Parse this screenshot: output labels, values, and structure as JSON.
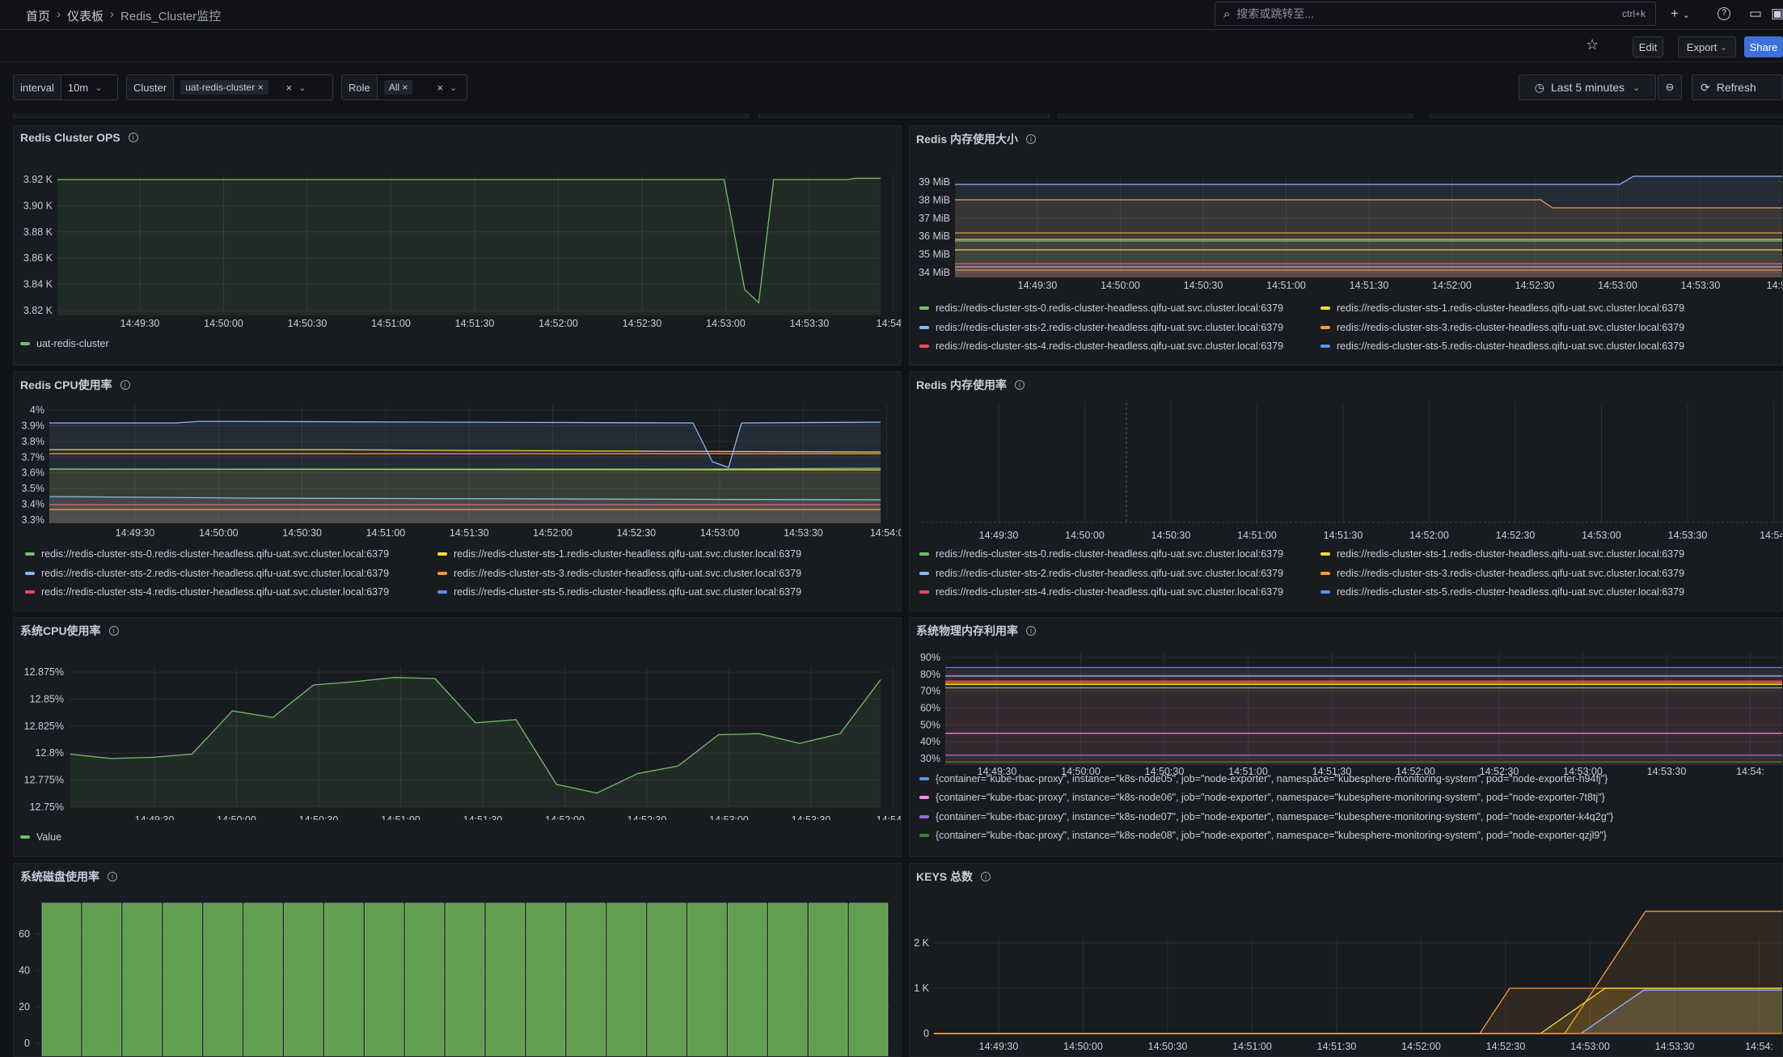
{
  "breadcrumb": {
    "home": "首页",
    "dashboards": "仪表板",
    "current": "Redis_Cluster监控"
  },
  "search": {
    "placeholder": "搜索或跳转至...",
    "shortcut": "ctrl+k"
  },
  "toolbar": {
    "edit": "Edit",
    "export": "Export",
    "share": "Share"
  },
  "variables": {
    "interval": {
      "label": "interval",
      "value": "10m"
    },
    "cluster": {
      "label": "Cluster",
      "value": "uat-redis-cluster"
    },
    "role": {
      "label": "Role",
      "value": "All"
    }
  },
  "timepicker": {
    "range": "Last 5 minutes",
    "refresh": "Refresh"
  },
  "legend_redis": [
    {
      "name": "redis://redis-cluster-sts-0.redis-cluster-headless.qifu-uat.svc.cluster.local:6379",
      "color": "#73bf69"
    },
    {
      "name": "redis://redis-cluster-sts-1.redis-cluster-headless.qifu-uat.svc.cluster.local:6379",
      "color": "#fade2a"
    },
    {
      "name": "redis://redis-cluster-sts-2.redis-cluster-headless.qifu-uat.svc.cluster.local:6379",
      "color": "#8ab8ff"
    },
    {
      "name": "redis://redis-cluster-sts-3.redis-cluster-headless.qifu-uat.svc.cluster.local:6379",
      "color": "#ff9830"
    },
    {
      "name": "redis://redis-cluster-sts-4.redis-cluster-headless.qifu-uat.svc.cluster.local:6379",
      "color": "#f2495c"
    },
    {
      "name": "redis://redis-cluster-sts-5.redis-cluster-headless.qifu-uat.svc.cluster.local:6379",
      "color": "#5794f2"
    }
  ],
  "panels": {
    "ops": {
      "title": "Redis Cluster OPS",
      "chart_data": {
        "type": "line",
        "x": [
          "14:49:30",
          "14:50:00",
          "14:50:30",
          "14:51:00",
          "14:51:30",
          "14:52:00",
          "14:52:30",
          "14:53:00",
          "14:53:30",
          "14:54:0"
        ],
        "yticks": [
          "3.92 K",
          "3.90 K",
          "3.88 K",
          "3.86 K",
          "3.84 K",
          "3.82 K"
        ],
        "ylim": [
          3815,
          3925
        ],
        "series": [
          {
            "name": "uat-redis-cluster",
            "color": "#73bf69",
            "points": [
              [
                0,
                3920
              ],
              [
                0.81,
                3920
              ],
              [
                0.835,
                3836
              ],
              [
                0.852,
                3826
              ],
              [
                0.87,
                3920
              ],
              [
                0.96,
                3920
              ],
              [
                0.97,
                3921
              ],
              [
                1,
                3921
              ]
            ]
          }
        ]
      }
    },
    "memsize": {
      "title": "Redis 内存使用大小",
      "chart_data": {
        "type": "line",
        "x": [
          "14:49:30",
          "14:50:00",
          "14:50:30",
          "14:51:00",
          "14:51:30",
          "14:52:00",
          "14:52:30",
          "14:53:00",
          "14:53:30",
          "14:54:0"
        ],
        "yticks": [
          "39 MiB",
          "38 MiB",
          "37 MiB",
          "36 MiB",
          "35 MiB",
          "34 MiB"
        ],
        "ylim": [
          33.6,
          39.6
        ]
      }
    },
    "cpu": {
      "title": "Redis CPU使用率",
      "chart_data": {
        "type": "line",
        "x": [
          "14:49:30",
          "14:50:00",
          "14:50:30",
          "14:51:00",
          "14:51:30",
          "14:52:00",
          "14:52:30",
          "14:53:00",
          "14:53:30",
          "14:54:0"
        ],
        "yticks": [
          "4%",
          "3.9%",
          "3.8%",
          "3.7%",
          "3.6%",
          "3.5%",
          "3.4%",
          "3.3%"
        ],
        "ylim": [
          3.3,
          4.0
        ]
      }
    },
    "memrate": {
      "title": "Redis 内存使用率",
      "chart_data": {
        "type": "line",
        "x": [
          "14:49:30",
          "14:50:00",
          "14:50:30",
          "14:51:00",
          "14:51:30",
          "14:52:00",
          "14:52:30",
          "14:53:00",
          "14:53:30",
          "14:54:"
        ]
      }
    },
    "syscpu": {
      "title": "系统CPU使用率",
      "chart_data": {
        "type": "line",
        "x": [
          "14:49:30",
          "14:50:00",
          "14:50:30",
          "14:51:00",
          "14:51:30",
          "14:52:00",
          "14:52:30",
          "14:53:00",
          "14:53:30",
          "14:54:0"
        ],
        "yticks": [
          "12.875%",
          "12.85%",
          "12.825%",
          "12.8%",
          "12.775%",
          "12.75%"
        ],
        "ylim": [
          12.75,
          12.88
        ],
        "series": [
          {
            "name": "Value",
            "color": "#73bf69",
            "values": [
              12.799,
              12.795,
              12.796,
              12.799,
              12.839,
              12.833,
              12.863,
              12.866,
              12.87,
              12.869,
              12.828,
              12.831,
              12.771,
              12.763,
              12.781,
              12.788,
              12.817,
              12.818,
              12.809,
              12.818,
              12.868
            ]
          }
        ]
      }
    },
    "sysmem": {
      "title": "系统物理内存利用率",
      "chart_data": {
        "type": "line",
        "x": [
          "14:49:30",
          "14:50:00",
          "14:50:30",
          "14:51:00",
          "14:51:30",
          "14:52:00",
          "14:52:30",
          "14:53:00",
          "14:53:30",
          "14:54:"
        ],
        "yticks": [
          "90%",
          "80%",
          "70%",
          "60%",
          "50%",
          "40%",
          "30%"
        ],
        "ylim": [
          25,
          90
        ]
      },
      "legend": [
        {
          "name": "{container=\"kube-rbac-proxy\", instance=\"k8s-node05\", job=\"node-exporter\", namespace=\"kubesphere-monitoring-system\", pod=\"node-exporter-h94fj\"}",
          "color": "#5794f2"
        },
        {
          "name": "{container=\"kube-rbac-proxy\", instance=\"k8s-node06\", job=\"node-exporter\", namespace=\"kubesphere-monitoring-system\", pod=\"node-exporter-7t8tj\"}",
          "color": "#ff8ae9"
        },
        {
          "name": "{container=\"kube-rbac-proxy\", instance=\"k8s-node07\", job=\"node-exporter\", namespace=\"kubesphere-monitoring-system\", pod=\"node-exporter-k4q2g\"}",
          "color": "#8f6fd8"
        },
        {
          "name": "{container=\"kube-rbac-proxy\", instance=\"k8s-node08\", job=\"node-exporter\", namespace=\"kubesphere-monitoring-system\", pod=\"node-exporter-qzjl9\"}",
          "color": "#37872d"
        }
      ]
    },
    "disk": {
      "title": "系统磁盘使用率",
      "chart_data": {
        "type": "bar",
        "yticks": [
          "60",
          "40",
          "20",
          "0"
        ],
        "ylim": [
          0,
          80
        ],
        "values": [
          77,
          77,
          77,
          77,
          77,
          77,
          77,
          77,
          77,
          77,
          77,
          77,
          77,
          77,
          77,
          77,
          77,
          77,
          77,
          77,
          77
        ],
        "color": "#629e51"
      }
    },
    "keys": {
      "title": "KEYS 总数",
      "chart_data": {
        "type": "area",
        "x": [
          "14:49:30",
          "14:50:00",
          "14:50:30",
          "14:51:00",
          "14:51:30",
          "14:52:00",
          "14:52:30",
          "14:53:00",
          "14:53:30",
          "14:54:"
        ],
        "yticks": [
          "2 K",
          "1 K",
          "0"
        ],
        "ylim": [
          0,
          2700
        ]
      }
    }
  }
}
